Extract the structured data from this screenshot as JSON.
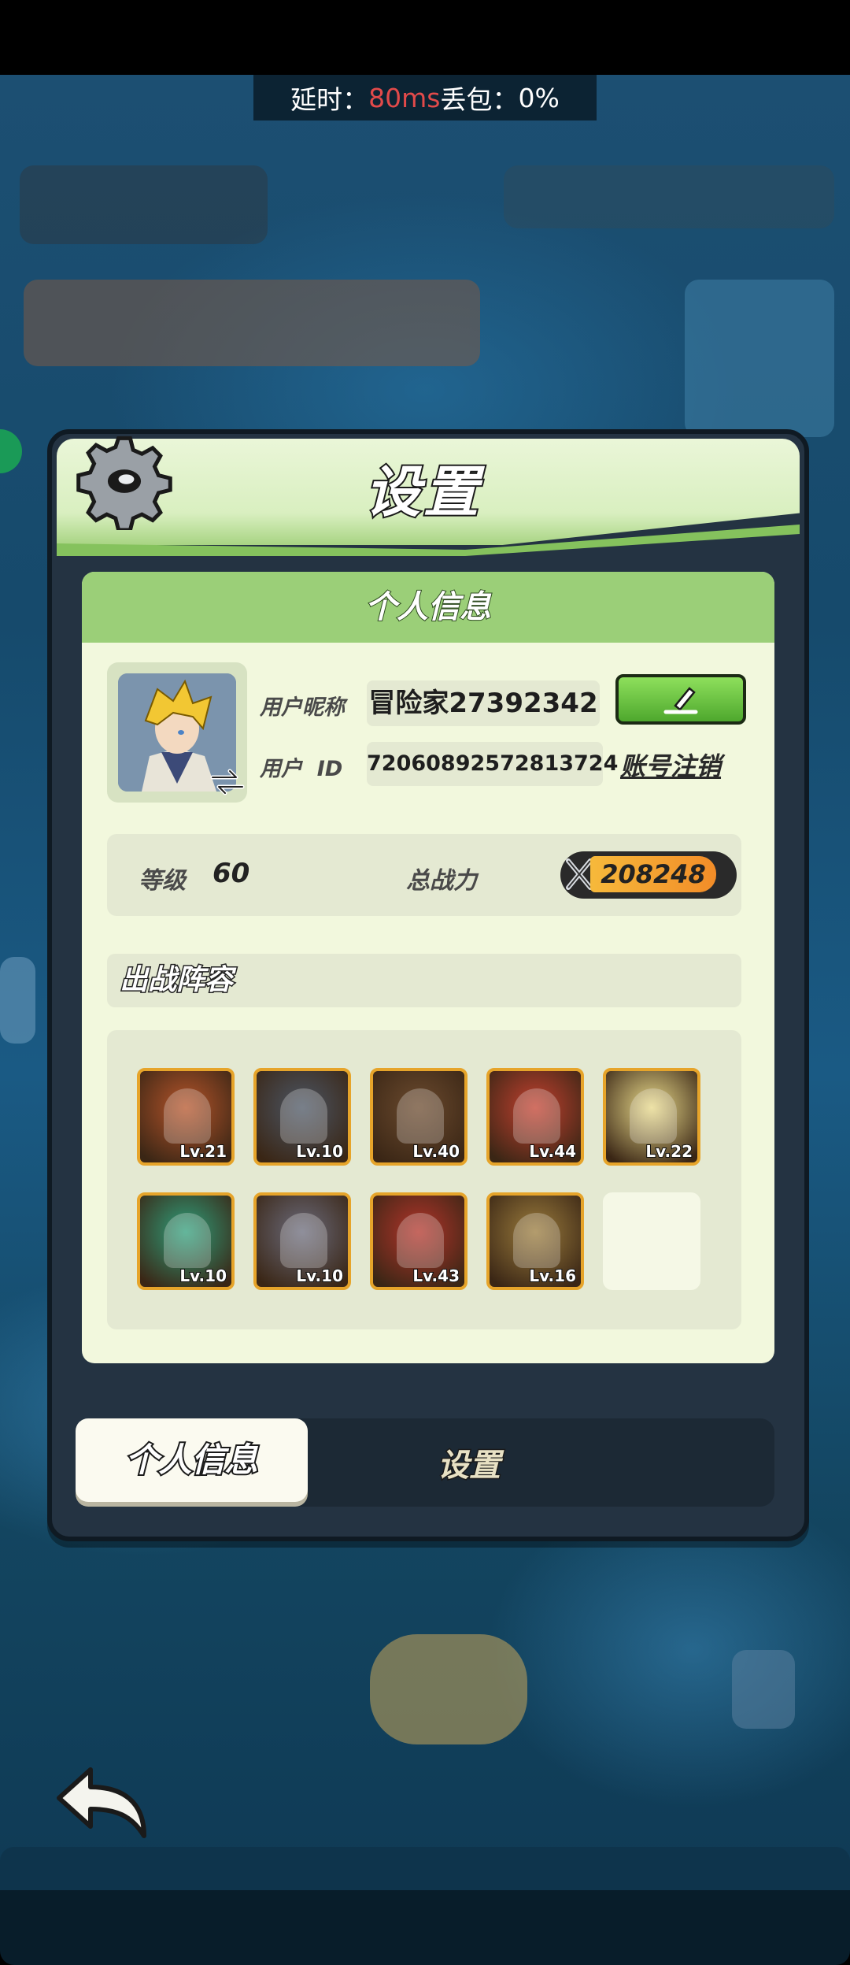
{
  "status": {
    "latency_label": "延时：",
    "latency_value": "80ms",
    "loss_label": " 丢包：",
    "loss_value": "0%"
  },
  "dialog": {
    "title": "设置",
    "panel_title": "个人信息",
    "nickname_label": "用户昵称",
    "nickname_value": "冒险家27392342",
    "id_label": "用户  ID",
    "id_value": "72060892572813724",
    "cancel_account": "账号注销",
    "level_label": "等级",
    "level_value": "60",
    "power_label": "总战力",
    "power_value": "208248",
    "lineup_title": "出战阵容",
    "heroes": [
      {
        "level": "Lv.21",
        "color": "#b5542a"
      },
      {
        "level": "Lv.10",
        "color": "#4b5563"
      },
      {
        "level": "Lv.40",
        "color": "#6b4a2e"
      },
      {
        "level": "Lv.44",
        "color": "#c2402f"
      },
      {
        "level": "Lv.22",
        "color": "#e8d98a"
      },
      {
        "level": "Lv.10",
        "color": "#2f9e7a"
      },
      {
        "level": "Lv.10",
        "color": "#6a6a7a"
      },
      {
        "level": "Lv.43",
        "color": "#b2342a"
      },
      {
        "level": "Lv.16",
        "color": "#9a7b3c"
      }
    ]
  },
  "tabs": {
    "active": "个人信息",
    "inactive": "设置"
  }
}
